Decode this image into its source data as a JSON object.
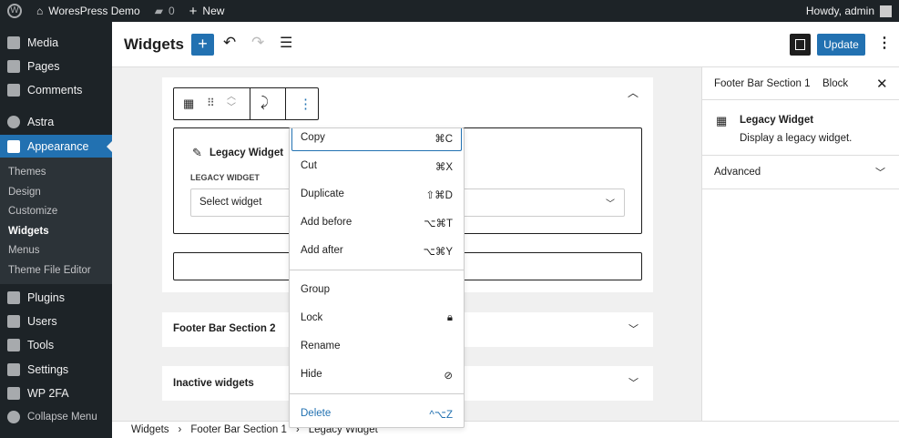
{
  "adminbar": {
    "site_name": "WoresPress Demo",
    "comments_count": "0",
    "new_label": "New",
    "howdy": "Howdy, admin"
  },
  "sidebar": {
    "items": [
      {
        "label": "Media"
      },
      {
        "label": "Pages"
      },
      {
        "label": "Comments"
      },
      {
        "label": "Astra"
      },
      {
        "label": "Appearance"
      },
      {
        "label": "Plugins"
      },
      {
        "label": "Users"
      },
      {
        "label": "Tools"
      },
      {
        "label": "Settings"
      },
      {
        "label": "WP 2FA"
      },
      {
        "label": "Collapse Menu"
      }
    ],
    "submenu": [
      "Themes",
      "Design",
      "Customize",
      "Widgets",
      "Menus",
      "Theme File Editor"
    ]
  },
  "header": {
    "title": "Widgets",
    "update_label": "Update"
  },
  "block": {
    "title": "Legacy Widget",
    "field_label": "LEGACY WIDGET",
    "select_value": "Select widget"
  },
  "areas": [
    {
      "label": "Footer Bar Section 2"
    },
    {
      "label": "Inactive widgets"
    }
  ],
  "menu": {
    "items": [
      {
        "label": "Copy",
        "shortcut": "⌘C"
      },
      {
        "label": "Cut",
        "shortcut": "⌘X"
      },
      {
        "label": "Duplicate",
        "shortcut": "⇧⌘D"
      },
      {
        "label": "Add before",
        "shortcut": "⌥⌘T"
      },
      {
        "label": "Add after",
        "shortcut": "⌥⌘Y"
      },
      {
        "label": "Group",
        "shortcut": ""
      },
      {
        "label": "Lock",
        "shortcut": ""
      },
      {
        "label": "Rename",
        "shortcut": ""
      },
      {
        "label": "Hide",
        "shortcut": ""
      }
    ],
    "delete": {
      "label": "Delete",
      "shortcut": "^⌥Z"
    }
  },
  "panel": {
    "tab1": "Footer Bar Section 1",
    "tab2": "Block",
    "block_name": "Legacy Widget",
    "block_desc": "Display a legacy widget.",
    "advanced": "Advanced"
  },
  "breadcrumb": [
    "Widgets",
    "Footer Bar Section 1",
    "Legacy Widget"
  ]
}
